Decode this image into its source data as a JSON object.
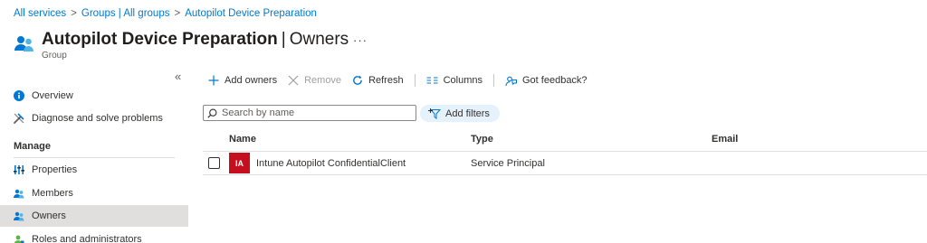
{
  "breadcrumb": {
    "items": [
      "All services",
      "Groups | All groups",
      "Autopilot Device Preparation"
    ],
    "separator": ">"
  },
  "header": {
    "title_main": "Autopilot Device Preparation",
    "title_divider": "|",
    "title_section": "Owners",
    "subtitle": "Group",
    "more": "···"
  },
  "sidebar": {
    "collapse": "«",
    "items": [
      {
        "label": "Overview",
        "icon": "info-icon"
      },
      {
        "label": "Diagnose and solve problems",
        "icon": "wrench-icon"
      },
      {
        "label": "Properties",
        "icon": "properties-icon"
      },
      {
        "label": "Members",
        "icon": "members-icon"
      },
      {
        "label": "Owners",
        "icon": "owners-icon",
        "selected": true
      },
      {
        "label": "Roles and administrators",
        "icon": "roles-icon"
      }
    ],
    "section_label": "Manage"
  },
  "toolbar": {
    "add_owners": "Add owners",
    "remove": "Remove",
    "refresh": "Refresh",
    "columns": "Columns",
    "feedback": "Got feedback?"
  },
  "search": {
    "placeholder": "Search by name"
  },
  "filters": {
    "label": "Add filters"
  },
  "table": {
    "headers": {
      "name": "Name",
      "type": "Type",
      "email": "Email"
    },
    "rows": [
      {
        "initials": "IA",
        "name": "Intune Autopilot ConfidentialClient",
        "type": "Service Principal",
        "email": ""
      }
    ]
  },
  "colors": {
    "accent": "#0078d4",
    "selected_bg": "#e1dfdd",
    "avatar_bg": "#c50f1f",
    "filter_pill_bg": "#e5f1fb"
  }
}
